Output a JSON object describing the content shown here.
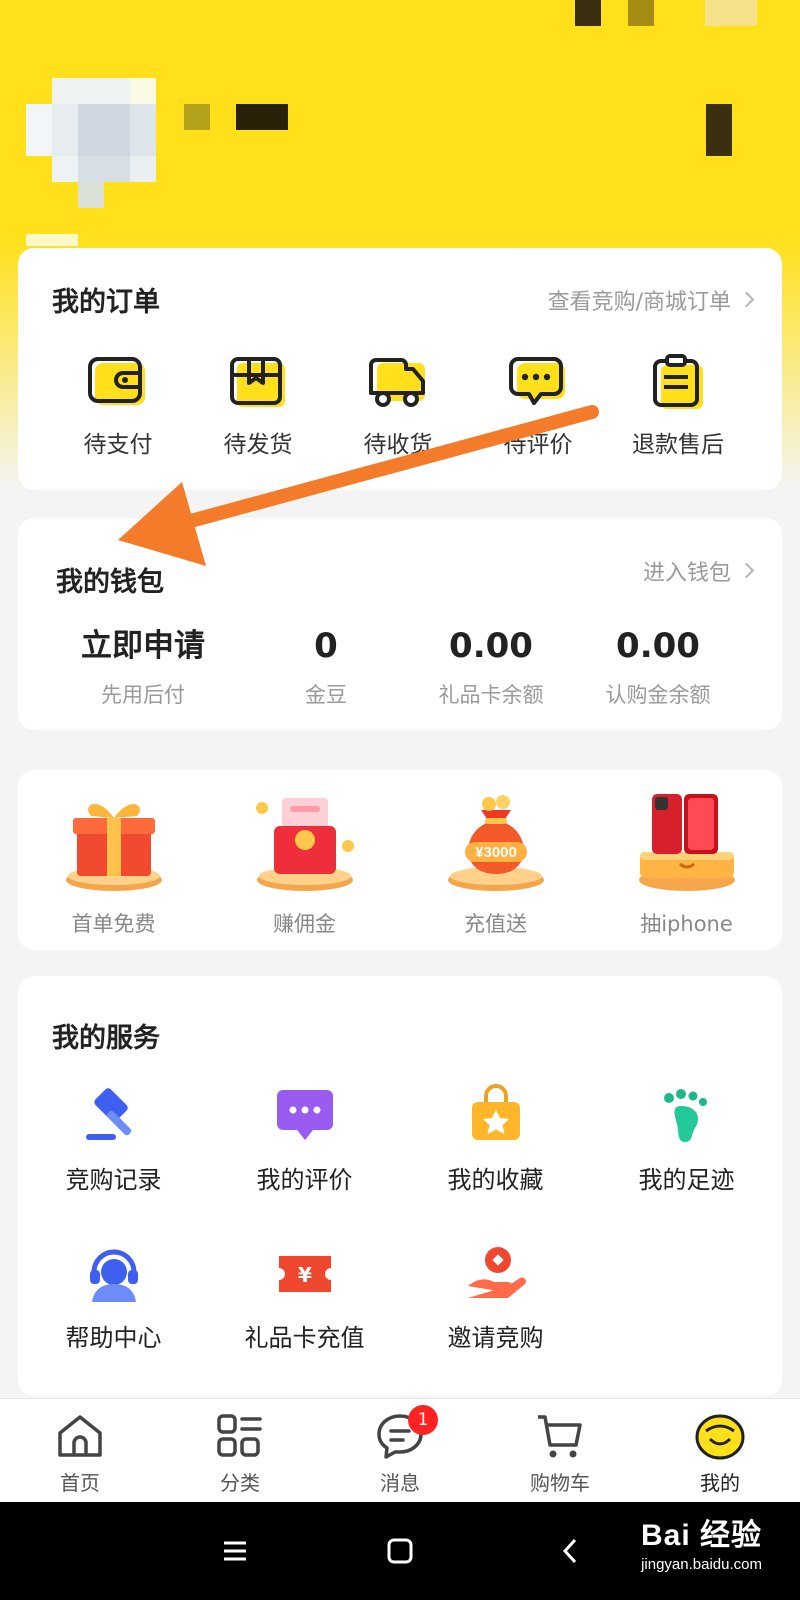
{
  "orders": {
    "title": "我的订单",
    "link": "查看竞购/商城订单",
    "items": [
      {
        "label": "待支付",
        "icon": "wallet-icon"
      },
      {
        "label": "待发货",
        "icon": "package-icon"
      },
      {
        "label": "待收货",
        "icon": "truck-icon"
      },
      {
        "label": "待评价",
        "icon": "comment-icon"
      },
      {
        "label": "退款售后",
        "icon": "clipboard-icon"
      }
    ]
  },
  "wallet": {
    "title": "我的钱包",
    "link": "进入钱包",
    "stats": [
      {
        "value": "立即申请",
        "caption": "先用后付"
      },
      {
        "value": "0",
        "caption": "金豆"
      },
      {
        "value": "0.00",
        "caption": "礼品卡余额"
      },
      {
        "value": "0.00",
        "caption": "认购金余额"
      }
    ]
  },
  "promos": [
    {
      "label": "首单免费",
      "icon": "gift-box-icon"
    },
    {
      "label": "赚佣金",
      "icon": "red-envelope-icon"
    },
    {
      "label": "充值送",
      "icon": "money-bag-icon",
      "bag_text": "¥3000"
    },
    {
      "label": "抽iphone",
      "icon": "iphone-icon"
    }
  ],
  "services": {
    "title": "我的服务",
    "items": [
      {
        "label": "竞购记录",
        "icon": "gavel-icon"
      },
      {
        "label": "我的评价",
        "icon": "chat-bubble-icon"
      },
      {
        "label": "我的收藏",
        "icon": "star-bag-icon"
      },
      {
        "label": "我的足迹",
        "icon": "footprint-icon"
      },
      {
        "label": "帮助中心",
        "icon": "support-agent-icon"
      },
      {
        "label": "礼品卡充值",
        "icon": "ticket-icon"
      },
      {
        "label": "邀请竞购",
        "icon": "hand-coin-icon"
      }
    ]
  },
  "tabbar": [
    {
      "label": "首页",
      "icon": "home-icon"
    },
    {
      "label": "分类",
      "icon": "category-icon"
    },
    {
      "label": "消息",
      "icon": "message-icon",
      "badge": "1"
    },
    {
      "label": "购物车",
      "icon": "cart-icon"
    },
    {
      "label": "我的",
      "icon": "mascot-icon"
    }
  ],
  "watermark": {
    "brand": "Bai 经验",
    "url": "jingyan.baidu.com"
  },
  "colors": {
    "brand_yellow": "#ffe01a",
    "arrow": "#f47b2a",
    "badge": "#ff2222",
    "service_blue": "#4a6cf0"
  }
}
